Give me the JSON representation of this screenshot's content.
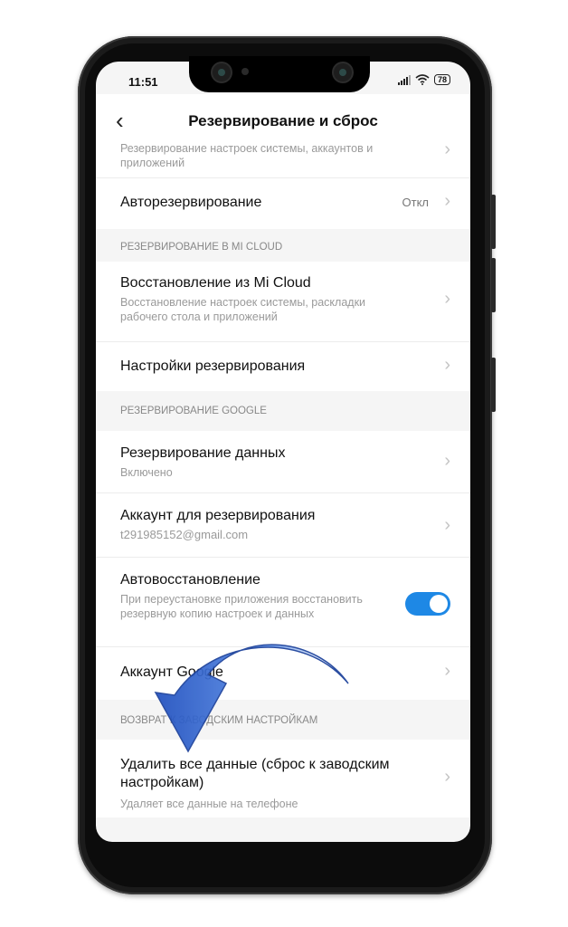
{
  "status": {
    "time": "11:51",
    "battery": "78"
  },
  "header": {
    "title": "Резервирование и сброс"
  },
  "items_top": {
    "partial_sub_1": "Резервирование настроек системы, аккаунтов и",
    "partial_sub_2": "приложений",
    "autobackup": {
      "title": "Авторезервирование",
      "value": "Откл"
    }
  },
  "mi_cloud": {
    "section": "РЕЗЕРВИРОВАНИЕ В MI CLOUD",
    "restore": {
      "title": "Восстановление из Mi Cloud",
      "subtitle": "Восстановление настроек системы, раскладки рабочего стола и приложений"
    },
    "settings": {
      "title": "Настройки резервирования"
    }
  },
  "google": {
    "section": "РЕЗЕРВИРОВАНИЕ GOOGLE",
    "backup_data": {
      "title": "Резервирование данных",
      "subtitle": "Включено"
    },
    "account": {
      "title": "Аккаунт для резервирования",
      "subtitle": "t291985152@gmail.com"
    },
    "autorestore": {
      "title": "Автовосстановление",
      "subtitle": "При переустановке приложения восстановить резервную копию настроек и данных",
      "enabled": true
    },
    "account_google": {
      "title": "Аккаунт Google"
    }
  },
  "reset": {
    "section": "ВОЗВРАТ К ЗАВОДСКИМ НАСТРОЙКАМ",
    "erase": {
      "title": "Удалить все данные (сброс к заводским настройкам)",
      "subtitle": "Удаляет все данные на телефоне"
    }
  },
  "colors": {
    "toggle": "#1e88e5",
    "arrow": "#3a6fd8"
  }
}
